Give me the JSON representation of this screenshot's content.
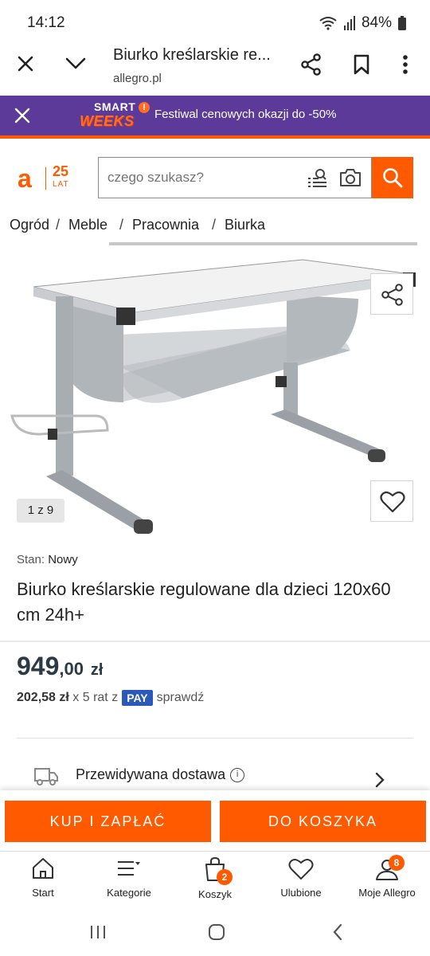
{
  "status_bar": {
    "time": "14:12",
    "battery": "84%"
  },
  "browser": {
    "title": "Biurko kreślarskie re...",
    "url": "allegro.pl"
  },
  "promo": {
    "brand_line1": "SMART",
    "brand_line2": "WEEKS",
    "text": "Festiwal cenowych okazji do -50%"
  },
  "header": {
    "logo_letter": "a",
    "logo_number": "25",
    "logo_sub": "LAT",
    "search_placeholder": "czego szukasz?"
  },
  "breadcrumbs": [
    "Ogród",
    "Meble",
    "Pracownia",
    "Biurka"
  ],
  "gallery": {
    "counter": "1 z 9"
  },
  "product": {
    "condition_label": "Stan:",
    "condition_value": "Nowy",
    "title": "Biurko kreślarskie regulowane dla dzieci 120x60 cm 24h+",
    "price_int": "949",
    "price_dec": ",00",
    "currency": "zł",
    "installment_amount": "202,58 zł",
    "installment_text": "x 5 rat z",
    "pay_badge": "PAY",
    "installment_link": "sprawdź",
    "delivery_label": "Przewidywana dostawa"
  },
  "actions": {
    "buy_now": "KUP I ZAPŁAĆ",
    "add_to_cart": "DO KOSZYKA"
  },
  "bottom_nav": {
    "items": [
      {
        "label": "Start",
        "icon": "home-icon"
      },
      {
        "label": "Kategorie",
        "icon": "menu-icon"
      },
      {
        "label": "Koszyk",
        "icon": "cart-icon",
        "badge": "2"
      },
      {
        "label": "Ulubione",
        "icon": "heart-icon"
      },
      {
        "label": "Moje Allegro",
        "icon": "user-icon",
        "badge": "8"
      }
    ]
  },
  "colors": {
    "brand_orange": "#ff5a00",
    "promo_purple": "#5b3a99",
    "pay_blue": "#2a59b9"
  }
}
